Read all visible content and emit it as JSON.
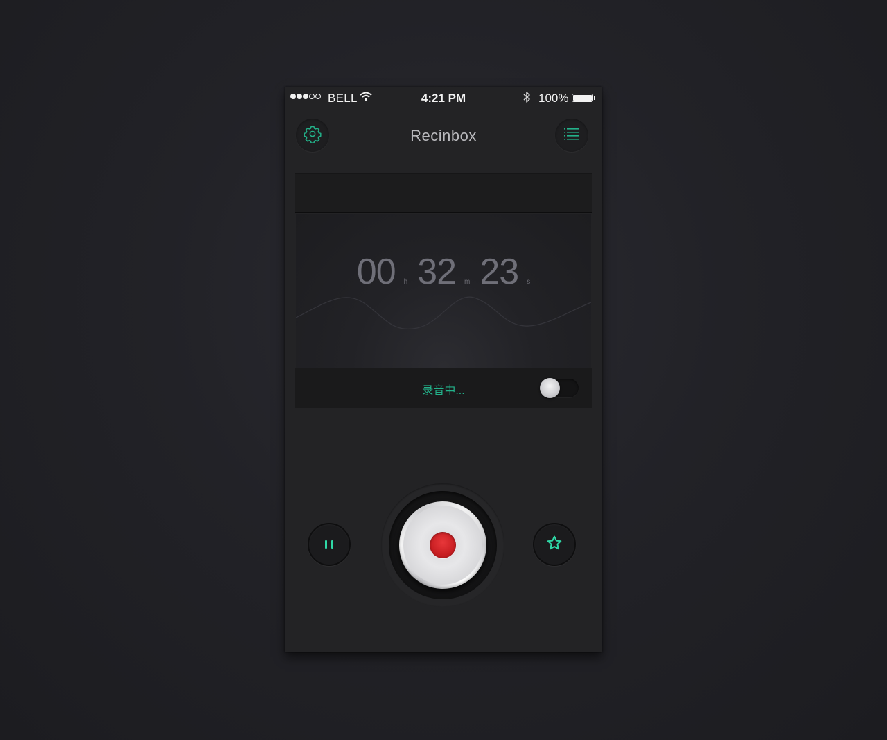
{
  "status_bar": {
    "carrier": "BELL",
    "signal_bars_filled": 3,
    "signal_bars_total": 5,
    "time": "4:21 PM",
    "battery_percent": "100%"
  },
  "header": {
    "title": "Recinbox",
    "left_icon": "gear-icon",
    "right_icon": "list-icon"
  },
  "timer": {
    "hours": "00",
    "hours_unit": "h",
    "minutes": "32",
    "minutes_unit": "m",
    "seconds": "23",
    "seconds_unit": "s"
  },
  "recording": {
    "status_label": "录音中...",
    "toggle_on": false
  },
  "controls": {
    "left_icon": "pause-icon",
    "center_icon": "record-icon",
    "right_icon": "star-icon"
  },
  "colors": {
    "accent": "#2fd8a6",
    "status_text": "#23b28a",
    "record_red": "#d12226",
    "background": "#232325"
  }
}
